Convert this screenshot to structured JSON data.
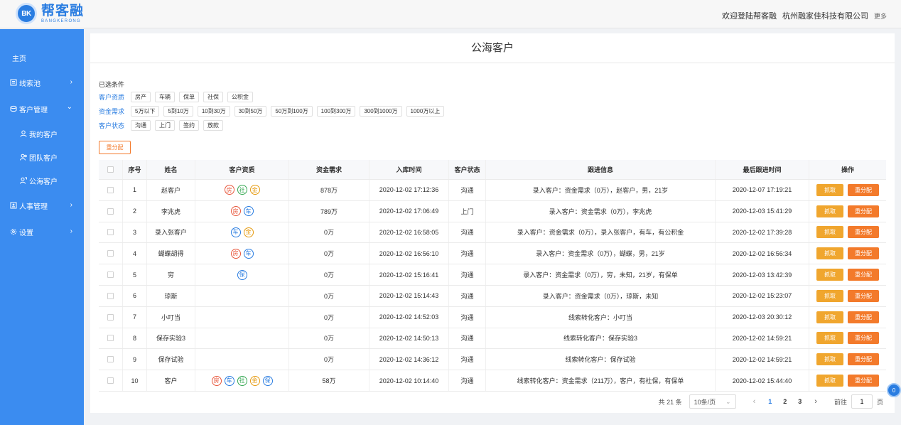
{
  "header": {
    "logo_badge": "BK",
    "logo_cn": "帮客融",
    "logo_en": "BANGKERONG",
    "welcome": "欢迎登陆帮客融",
    "company": "杭州融家佳科技有限公司",
    "more": "更多"
  },
  "sidebar": {
    "home": "主页",
    "items": [
      {
        "label": "线索池",
        "icon": "list-icon"
      },
      {
        "label": "客户管理",
        "icon": "customers-icon"
      },
      {
        "label": "人事管理",
        "icon": "hr-icon"
      },
      {
        "label": "设置",
        "icon": "gear-icon"
      }
    ],
    "sub": [
      {
        "label": "我的客户",
        "icon": "user-icon"
      },
      {
        "label": "团队客户",
        "icon": "team-icon"
      },
      {
        "label": "公海客户",
        "icon": "public-customers-icon"
      }
    ],
    "chev_right": "›",
    "chev_down": "⌄"
  },
  "page": {
    "title": "公海客户",
    "filter_title": "已选条件",
    "filters": [
      {
        "label": "客户资质",
        "chips": [
          "房产",
          "车辆",
          "保单",
          "社保",
          "公积金"
        ]
      },
      {
        "label": "资金需求",
        "chips": [
          "5万以下",
          "5到10万",
          "10到30万",
          "30到50万",
          "50万到100万",
          "100到300万",
          "300到1000万",
          "1000万以上"
        ]
      },
      {
        "label": "客户状态",
        "chips": [
          "沟通",
          "上门",
          "签约",
          "放款"
        ]
      }
    ],
    "redistribute_label": "重分配"
  },
  "table": {
    "headers": [
      "",
      "序号",
      "姓名",
      "客户资质",
      "资金需求",
      "入库时间",
      "客户状态",
      "跟进信息",
      "最后跟进时间",
      "操作"
    ],
    "grab_label": "抓取",
    "redist_label": "重分配",
    "rows": [
      {
        "no": "1",
        "name": "赵客户",
        "quals": [
          "房",
          "社",
          "金"
        ],
        "fund": "878万",
        "time": "2020-12-02 17:12:36",
        "status": "沟通",
        "follow": "录入客户：资金需求（0万），赵客户，男，21岁",
        "last": "2020-12-07 17:19:21"
      },
      {
        "no": "2",
        "name": "李兆虎",
        "quals": [
          "房",
          "车"
        ],
        "fund": "789万",
        "time": "2020-12-02 17:06:49",
        "status": "上门",
        "follow": "录入客户：资金需求（0万），李兆虎",
        "last": "2020-12-03 15:41:29"
      },
      {
        "no": "3",
        "name": "录入张客户",
        "quals": [
          "车",
          "金"
        ],
        "fund": "0万",
        "time": "2020-12-02 16:58:05",
        "status": "沟通",
        "follow": "录入客户：资金需求（0万），录入张客户，有车，有公积金",
        "last": "2020-12-02 17:39:28"
      },
      {
        "no": "4",
        "name": "蝴蝶胡得",
        "quals": [
          "房",
          "车"
        ],
        "fund": "0万",
        "time": "2020-12-02 16:56:10",
        "status": "沟通",
        "follow": "录入客户：资金需求（0万），蝴蝶，男，21岁",
        "last": "2020-12-02 16:56:34"
      },
      {
        "no": "5",
        "name": "穷",
        "quals": [
          "保"
        ],
        "fund": "0万",
        "time": "2020-12-02 15:16:41",
        "status": "沟通",
        "follow": "录入客户：资金需求（0万），穷，未知，21岁，有保单",
        "last": "2020-12-03 13:42:39"
      },
      {
        "no": "6",
        "name": "琼斯",
        "quals": [],
        "fund": "0万",
        "time": "2020-12-02 15:14:43",
        "status": "沟通",
        "follow": "录入客户：资金需求（0万），琼斯，未知",
        "last": "2020-12-02 15:23:07"
      },
      {
        "no": "7",
        "name": "小叮当",
        "quals": [],
        "fund": "0万",
        "time": "2020-12-02 14:52:03",
        "status": "沟通",
        "follow": "线索转化客户：小叮当",
        "last": "2020-12-03 20:30:12"
      },
      {
        "no": "8",
        "name": "保存实验3",
        "quals": [],
        "fund": "0万",
        "time": "2020-12-02 14:50:13",
        "status": "沟通",
        "follow": "线索转化客户：保存实验3",
        "last": "2020-12-02 14:59:21"
      },
      {
        "no": "9",
        "name": "保存试验",
        "quals": [],
        "fund": "0万",
        "time": "2020-12-02 14:36:12",
        "status": "沟通",
        "follow": "线索转化客户：保存试验",
        "last": "2020-12-02 14:59:21"
      },
      {
        "no": "10",
        "name": "客户",
        "quals": [
          "房",
          "车",
          "社",
          "金",
          "保"
        ],
        "fund": "58万",
        "time": "2020-12-02 10:14:40",
        "status": "沟通",
        "follow": "线索转化客户：资金需求（211万），客户，有社保，有保单",
        "last": "2020-12-02 15:44:40"
      }
    ]
  },
  "pager": {
    "total": "共 21 条",
    "size": "10条/页",
    "pages": [
      "1",
      "2",
      "3"
    ],
    "active": "1",
    "goto_pre": "前往",
    "goto_val": "1",
    "goto_post": "页"
  },
  "float_badge": "0"
}
